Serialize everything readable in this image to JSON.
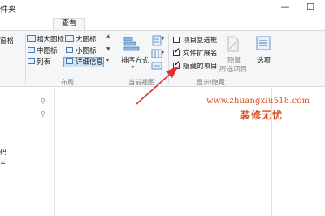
{
  "window": {
    "title": "件夹",
    "minimize_glyph": "—",
    "maximize_glyph": "☐"
  },
  "tabs": {
    "active": "查看"
  },
  "ribbon": {
    "panes": {
      "item1": "窗格"
    },
    "layout": {
      "items": [
        "超大图标",
        "大图标",
        "中图标",
        "小图标",
        "列表",
        "详细信息"
      ],
      "selected": "详细信息",
      "group_label": "布局"
    },
    "current_view": {
      "sort_label": "排序方式",
      "group_label": "当前视图"
    },
    "show_hide": {
      "checkboxes": [
        {
          "label": "项目复选框",
          "checked": false
        },
        {
          "label": "文件扩展名",
          "checked": true
        },
        {
          "label": "隐藏的项目",
          "checked": true
        }
      ],
      "hide_selected_line1": "隐藏",
      "hide_selected_line2": "所选项目",
      "group_label": "显示/隐藏"
    },
    "options_label": "选项"
  },
  "nav_pane": {
    "items": [
      "码",
      "="
    ]
  },
  "watermark": {
    "url": "www.zhuangxiu518.com",
    "name": "装修无忧"
  },
  "colors": {
    "arrow": "#e03030",
    "watermark": "#d6512a",
    "selection": "#cde4f7"
  },
  "icons": [
    "pin-icon",
    "sort-icon",
    "options-icon",
    "hide-selected-icon",
    "checkbox-checked-icon"
  ]
}
